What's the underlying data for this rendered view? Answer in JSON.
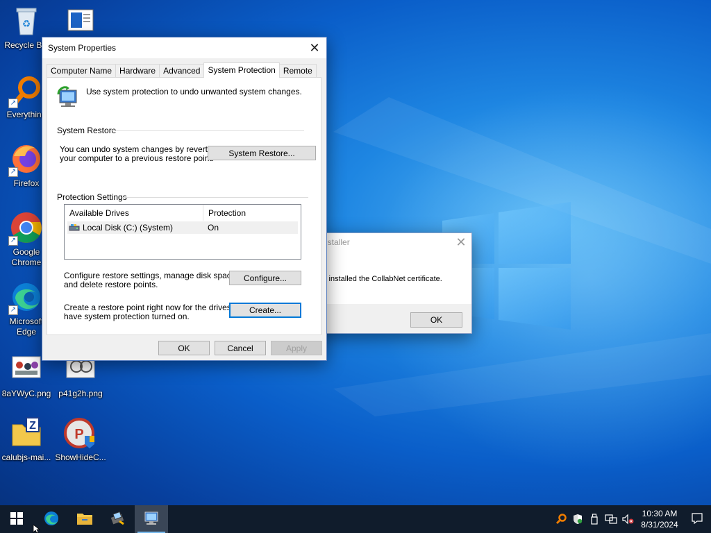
{
  "desktop_icons": [
    {
      "label": "Recycle Bin",
      "icon": "recycle-bin-icon"
    },
    {
      "label": "Everything",
      "icon": "everything-search-icon"
    },
    {
      "label": "Firefox",
      "icon": "firefox-icon"
    },
    {
      "label": "Google Chrome",
      "icon": "chrome-icon"
    },
    {
      "label": "Microsoft Edge",
      "icon": "edge-icon"
    },
    {
      "label": "8aYWyC.png",
      "icon": "image-file-icon"
    },
    {
      "label": "calubjs-mai...",
      "icon": "zip-folder-icon"
    },
    {
      "label": "p41g2h.png",
      "icon": "image-file-icon"
    },
    {
      "label": "ShowHideC...",
      "icon": "showhide-app-icon"
    },
    {
      "label": "",
      "icon": "document-icon"
    }
  ],
  "installer_dialog": {
    "title": "nstaller",
    "message": "y installed the CollabNet certificate.",
    "ok_label": "OK"
  },
  "system_properties": {
    "title": "System Properties",
    "tabs": [
      "Computer Name",
      "Hardware",
      "Advanced",
      "System Protection",
      "Remote"
    ],
    "active_tab": "System Protection",
    "intro": "Use system protection to undo unwanted system changes.",
    "system_restore_group": "System Restore",
    "restore_text_line1": "You can undo system changes by reverting",
    "restore_text_line2": "your computer to a previous restore point.",
    "system_restore_button": "System Restore...",
    "protection_group": "Protection Settings",
    "columns": [
      "Available Drives",
      "Protection"
    ],
    "drives": [
      {
        "name": "Local Disk (C:) (System)",
        "protection": "On"
      }
    ],
    "configure_text_line1": "Configure restore settings, manage disk space,",
    "configure_text_line2": "and delete restore points.",
    "configure_button": "Configure...",
    "create_text_line1": "Create a restore point right now for the drives that",
    "create_text_line2": "have system protection turned on.",
    "create_button": "Create...",
    "ok_button": "OK",
    "cancel_button": "Cancel",
    "apply_button": "Apply"
  },
  "taskbar": {
    "pinned": [
      "start-icon",
      "edge-icon",
      "file-explorer-icon",
      "installer-icon",
      "system-properties-icon"
    ],
    "time": "10:30 AM",
    "date": "8/31/2024"
  }
}
